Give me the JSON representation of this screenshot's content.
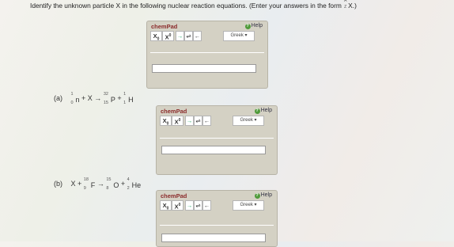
{
  "instruction": {
    "text": "Identify the unknown particle X in the following nuclear reaction equations. (Enter your answers in the form",
    "form_A": "A",
    "form_Z": "Z",
    "form_symbol": "X.)"
  },
  "chempad": {
    "title": "chemPad",
    "help": "Help",
    "sub_symbol": "X",
    "sub_mark": "0",
    "sup_symbol": "X",
    "sup_mark": "0",
    "arrow_right": "→",
    "arrow_eq": "⇌",
    "arrow_left": "←",
    "greek": "Greek ▾"
  },
  "questions": {
    "a": {
      "label": "(a)",
      "n_sym": "n",
      "n_A": "1",
      "n_Z": "0",
      "plus1": "+ X →",
      "p_sym": "P",
      "p_A": "32",
      "p_Z": "15",
      "plus2": "+",
      "h_sym": "H",
      "h_A": "1",
      "h_Z": "1"
    },
    "b": {
      "label": "(b)",
      "x": "X +",
      "f_sym": "F",
      "f_A": "18",
      "f_Z": "9",
      "arrow": "→",
      "o_sym": "O",
      "o_A": "15",
      "o_Z": "8",
      "plus": "+",
      "he_sym": "He",
      "he_A": "4",
      "he_Z": "2"
    }
  }
}
